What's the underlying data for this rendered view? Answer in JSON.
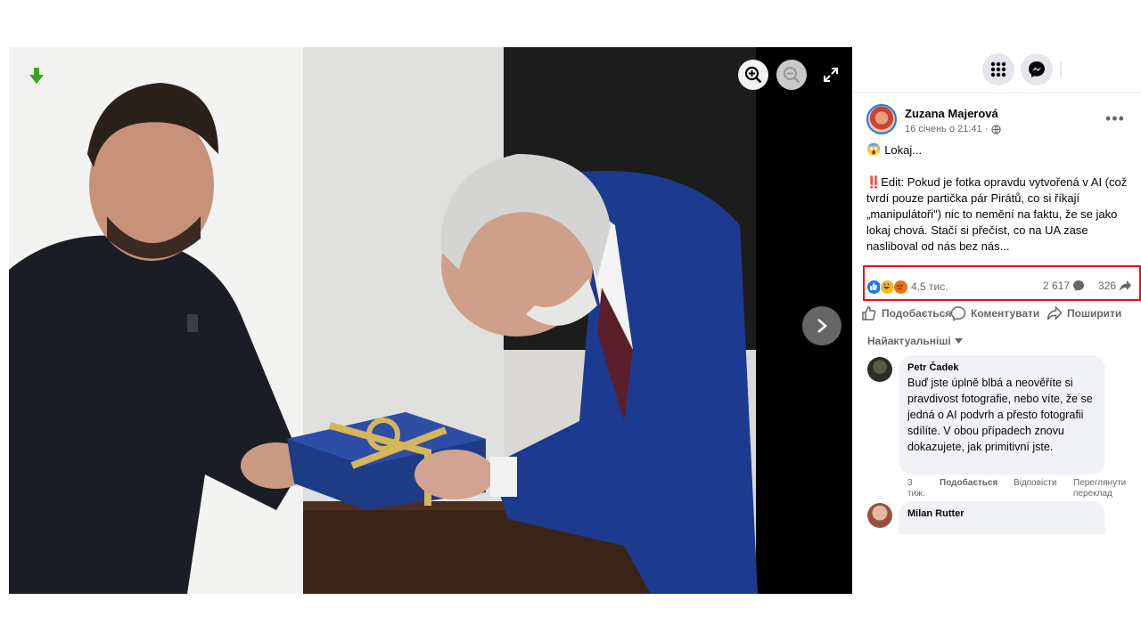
{
  "post": {
    "author": "Zuzana Majerová",
    "time": "16 січень о 21:41 ·",
    "emoji": "😱",
    "first_line": "Lokaj...",
    "edit_mark": "‼️",
    "body": "Edit: Pokud je fotka opravdu vytvořená v AI (což tvrdí pouze partička pár Pirátů, co si říkají „manipulátoři\") nic to nemění na faktu, že se jako lokaj chová. Stačí si přečíst, co na UA zase nasliboval od nás bez nás..."
  },
  "stats": {
    "reactions": "4,5 тис.",
    "comments": "2 617",
    "shares": "326"
  },
  "actions": {
    "like": "Подобається",
    "comment": "Коментувати",
    "share": "Поширити"
  },
  "comments": {
    "sort": "Найактуальніші",
    "items": [
      {
        "name": "Petr Čadek",
        "text": "Buď jste úplně blbá a neověříte si pravdivost fotografie, nebo víte, že se jedná o AI podvrh a přesto fotografii sdílíte. V obou případech znovu dokazujete, jak primitivní jste.",
        "time": "3 тиж.",
        "like": "Подобається",
        "reply": "Відповісти",
        "translate": "Переглянути переклад"
      },
      {
        "name": "Milan Rutter"
      }
    ]
  },
  "colors": {
    "accent": "#1877f2",
    "highlight": "#e0141e",
    "download_green": "#3aa21f"
  }
}
